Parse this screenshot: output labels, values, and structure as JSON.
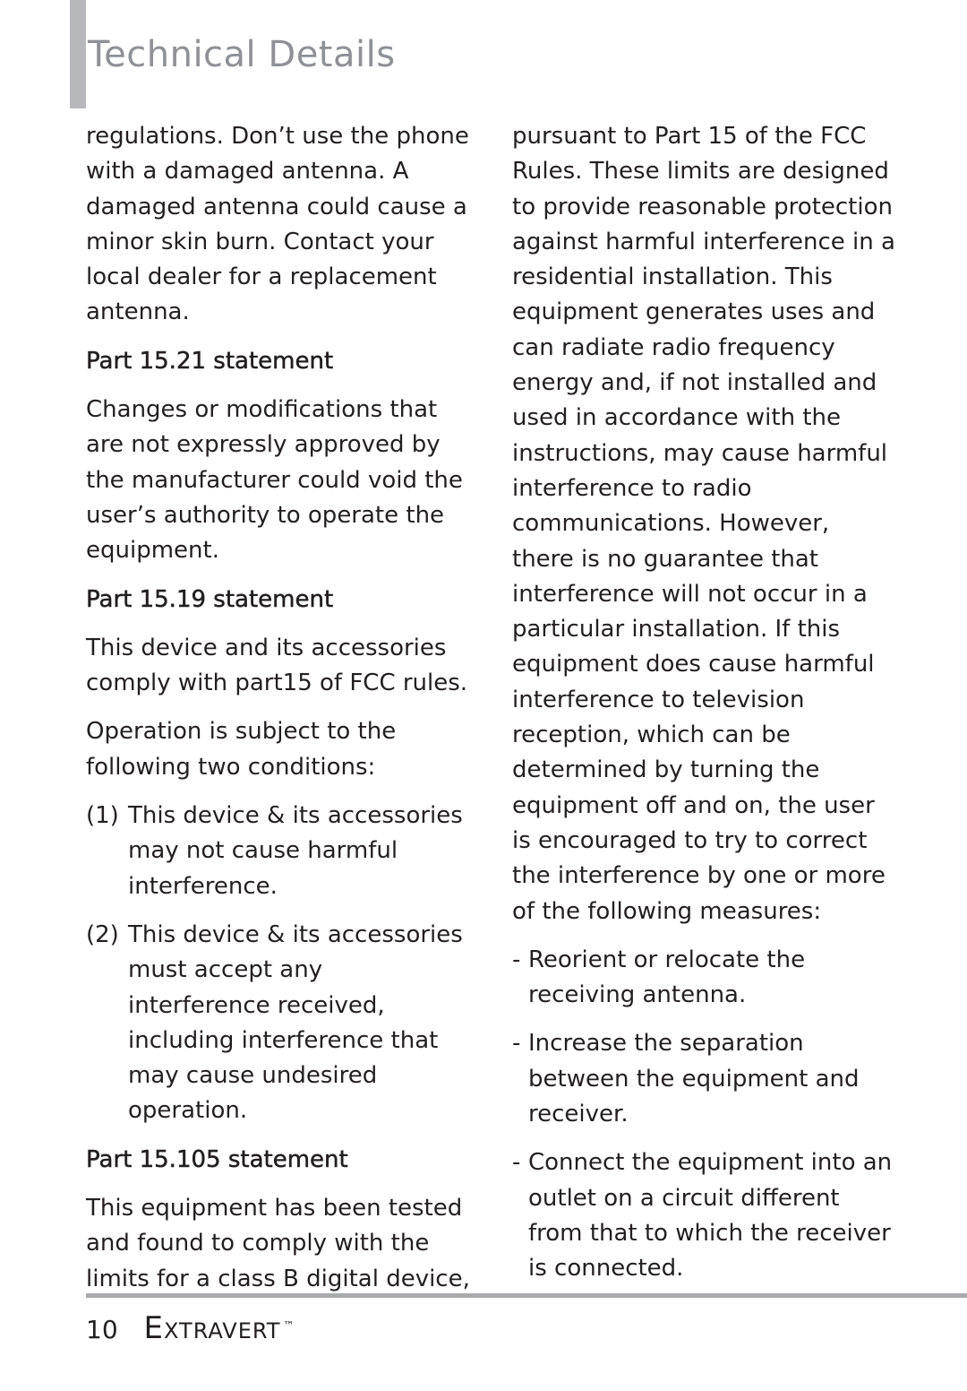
{
  "header": {
    "title": "Technical Details"
  },
  "left_column": {
    "intro": "regulations. Don’t use the phone with a damaged antenna. A damaged antenna could cause a minor skin burn. Contact your local dealer for a replacement antenna.",
    "sections": [
      {
        "heading": "Part 15.21 statement",
        "body": "Changes or modifications that are not expressly approved by the manufacturer could void the user’s authority to operate the equipment."
      },
      {
        "heading": "Part 15.19 statement",
        "body": "This device and its accessories comply with part15 of FCC rules.",
        "body2": "Operation is subject to the following two conditions:",
        "conditions": [
          {
            "num": "(1)",
            "text": "This device & its accessories may not cause harmful interference."
          },
          {
            "num": "(2)",
            "text": "This device & its accessories must accept any interference received, including interference that may cause undesired operation."
          }
        ]
      },
      {
        "heading": "Part 15.105 statement",
        "body": "This equipment has been tested and found to comply with the limits for a class B digital device,"
      }
    ]
  },
  "right_column": {
    "body": "pursuant to Part 15 of the FCC Rules. These limits are designed to provide reasonable protection against harmful interference in a residential installation. This equipment generates uses and can radiate radio frequency energy and, if not installed and used in accordance with the instructions, may cause harmful interference to radio communications. However, there is no guarantee that interference will not occur in a particular installation. If this equipment does cause harmful interference to television reception, which can be determined by turning the equipment off and on, the user is encouraged to try to correct the interference by one or more of the following measures:",
    "measures": [
      {
        "dash": "-",
        "text": "Reorient or relocate the receiving antenna."
      },
      {
        "dash": "-",
        "text": "Increase the separation between the equipment and receiver."
      },
      {
        "dash": "-",
        "text": "Connect the equipment into an outlet on a circuit different from that to which the receiver is connected."
      }
    ]
  },
  "footer": {
    "page_number": "10",
    "brand": "Extravert",
    "trademark": "™"
  },
  "colors": {
    "title": "#8e9195",
    "side_bar": "#b7b8bb",
    "text": "#231f20",
    "rule": "#a8abad"
  }
}
